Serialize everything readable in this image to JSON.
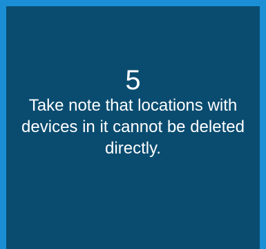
{
  "tile": {
    "step_number": "5",
    "text": "Take note that locations with devices in it cannot be deleted directly.",
    "colors": {
      "outer_border": "#1b8fd6",
      "card_background": "#0a4c70",
      "text": "#ffffff"
    }
  }
}
